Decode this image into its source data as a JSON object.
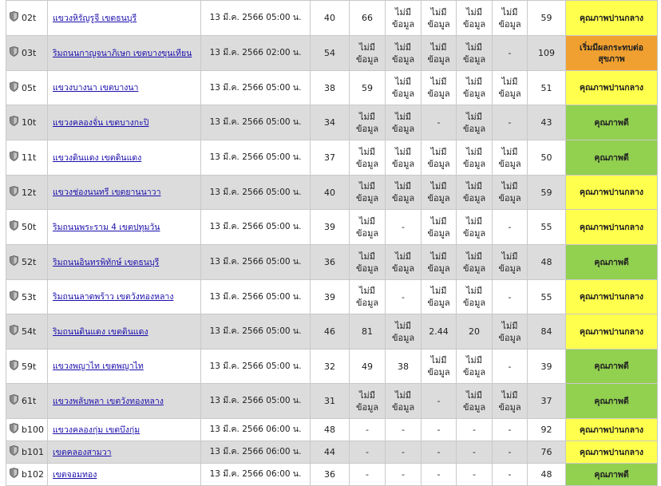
{
  "colors": {
    "moderate": "#ffff4d",
    "good": "#92d050",
    "sensitive": "#f0a030"
  },
  "icon": "shield-icon",
  "rows": [
    {
      "id": "02t",
      "loc": "แขวงหิรัญรูจี เขตธนบุรี",
      "dt": "13 มี.ค. 2566 05:00 น.",
      "v1": "40",
      "v2": "66",
      "v3": "ไม่มี\nข้อมูล",
      "v4": "ไม่มี\nข้อมูล",
      "v5": "ไม่มี\nข้อมูล",
      "v6": "ไม่มี\nข้อมูล",
      "aqi": "59",
      "q": "คุณภาพปานกลาง",
      "qc": "moderate"
    },
    {
      "id": "03t",
      "loc": "ริมถนนกาญจนาภิเษก เขตบางขุนเทียน",
      "dt": "13 มี.ค. 2566 02:00 น.",
      "v1": "54",
      "v2": "ไม่มี\nข้อมูล",
      "v3": "ไม่มี\nข้อมูล",
      "v4": "ไม่มี\nข้อมูล",
      "v5": "ไม่มี\nข้อมูล",
      "v6": "-",
      "aqi": "109",
      "q": "เริ่มมีผลกระทบต่อ\nสุขภาพ",
      "qc": "sensitive"
    },
    {
      "id": "05t",
      "loc": "แขวงบางนา เขตบางนา",
      "dt": "13 มี.ค. 2566 05:00 น.",
      "v1": "38",
      "v2": "59",
      "v3": "ไม่มี\nข้อมูล",
      "v4": "ไม่มี\nข้อมูล",
      "v5": "ไม่มี\nข้อมูล",
      "v6": "ไม่มี\nข้อมูล",
      "aqi": "51",
      "q": "คุณภาพปานกลาง",
      "qc": "moderate"
    },
    {
      "id": "10t",
      "loc": "แขวงคลองจั่น เขตบางกะปิ",
      "dt": "13 มี.ค. 2566 05:00 น.",
      "v1": "34",
      "v2": "ไม่มี\nข้อมูล",
      "v3": "ไม่มี\nข้อมูล",
      "v4": "-",
      "v5": "ไม่มี\nข้อมูล",
      "v6": "-",
      "aqi": "43",
      "q": "คุณภาพดี",
      "qc": "good"
    },
    {
      "id": "11t",
      "loc": "แขวงดินแดง เขตดินแดง",
      "dt": "13 มี.ค. 2566 05:00 น.",
      "v1": "37",
      "v2": "ไม่มี\nข้อมูล",
      "v3": "ไม่มี\nข้อมูล",
      "v4": "ไม่มี\nข้อมูล",
      "v5": "ไม่มี\nข้อมูล",
      "v6": "ไม่มี\nข้อมูล",
      "aqi": "50",
      "q": "คุณภาพดี",
      "qc": "good"
    },
    {
      "id": "12t",
      "loc": "แขวงช่องนนทรี เขตยานนาวา",
      "dt": "13 มี.ค. 2566 05:00 น.",
      "v1": "40",
      "v2": "ไม่มี\nข้อมูล",
      "v3": "ไม่มี\nข้อมูล",
      "v4": "ไม่มี\nข้อมูล",
      "v5": "ไม่มี\nข้อมูล",
      "v6": "ไม่มี\nข้อมูล",
      "aqi": "59",
      "q": "คุณภาพปานกลาง",
      "qc": "moderate"
    },
    {
      "id": "50t",
      "loc": "ริมถนนพระราม 4 เขตปทุมวัน",
      "dt": "13 มี.ค. 2566 05:00 น.",
      "v1": "39",
      "v2": "ไม่มี\nข้อมูล",
      "v3": "-",
      "v4": "ไม่มี\nข้อมูล",
      "v5": "ไม่มี\nข้อมูล",
      "v6": "-",
      "aqi": "55",
      "q": "คุณภาพปานกลาง",
      "qc": "moderate"
    },
    {
      "id": "52t",
      "loc": "ริมถนนอินทรพิทักษ์ เขตธนบุรี",
      "dt": "13 มี.ค. 2566 05:00 น.",
      "v1": "36",
      "v2": "ไม่มี\nข้อมูล",
      "v3": "ไม่มี\nข้อมูล",
      "v4": "ไม่มี\nข้อมูล",
      "v5": "ไม่มี\nข้อมูล",
      "v6": "ไม่มี\nข้อมูล",
      "aqi": "48",
      "q": "คุณภาพดี",
      "qc": "good"
    },
    {
      "id": "53t",
      "loc": "ริมถนนลาดพร้าว เขตวังทองหลาง",
      "dt": "13 มี.ค. 2566 05:00 น.",
      "v1": "39",
      "v2": "ไม่มี\nข้อมูล",
      "v3": "-",
      "v4": "ไม่มี\nข้อมูล",
      "v5": "ไม่มี\nข้อมูล",
      "v6": "-",
      "aqi": "55",
      "q": "คุณภาพปานกลาง",
      "qc": "moderate"
    },
    {
      "id": "54t",
      "loc": "ริมถนนดินแดง เขตดินแดง",
      "dt": "13 มี.ค. 2566 05:00 น.",
      "v1": "46",
      "v2": "81",
      "v3": "ไม่มี\nข้อมูล",
      "v4": "2.44",
      "v5": "20",
      "v6": "ไม่มี\nข้อมูล",
      "aqi": "84",
      "q": "คุณภาพปานกลาง",
      "qc": "moderate"
    },
    {
      "id": "59t",
      "loc": "แขวงพญาไท เขตพญาไท",
      "dt": "13 มี.ค. 2566 05:00 น.",
      "v1": "32",
      "v2": "49",
      "v3": "38",
      "v4": "ไม่มี\nข้อมูล",
      "v5": "ไม่มี\nข้อมูล",
      "v6": "-",
      "aqi": "39",
      "q": "คุณภาพดี",
      "qc": "good"
    },
    {
      "id": "61t",
      "loc": "แขวงพลับพลา เขตวังทองหลาง",
      "dt": "13 มี.ค. 2566 05:00 น.",
      "v1": "31",
      "v2": "ไม่มี\nข้อมูล",
      "v3": "ไม่มี\nข้อมูล",
      "v4": "-",
      "v5": "ไม่มี\nข้อมูล",
      "v6": "ไม่มี\nข้อมูล",
      "aqi": "37",
      "q": "คุณภาพดี",
      "qc": "good"
    },
    {
      "id": "b100",
      "loc": "แขวงคลองกุ่ม เขตบึงกุ่ม",
      "dt": "13 มี.ค. 2566 06:00 น.",
      "v1": "48",
      "v2": "-",
      "v3": "-",
      "v4": "-",
      "v5": "-",
      "v6": "-",
      "aqi": "92",
      "q": "คุณภาพปานกลาง",
      "qc": "moderate"
    },
    {
      "id": "b101",
      "loc": "เขตคลองสามวา",
      "dt": "13 มี.ค. 2566 06:00 น.",
      "v1": "44",
      "v2": "-",
      "v3": "-",
      "v4": "-",
      "v5": "-",
      "v6": "-",
      "aqi": "76",
      "q": "คุณภาพปานกลาง",
      "qc": "moderate"
    },
    {
      "id": "b102",
      "loc": "เขตจอมทอง",
      "dt": "13 มี.ค. 2566 06:00 น.",
      "v1": "36",
      "v2": "-",
      "v3": "-",
      "v4": "-",
      "v5": "-",
      "v6": "-",
      "aqi": "48",
      "q": "คุณภาพดี",
      "qc": "good"
    }
  ]
}
